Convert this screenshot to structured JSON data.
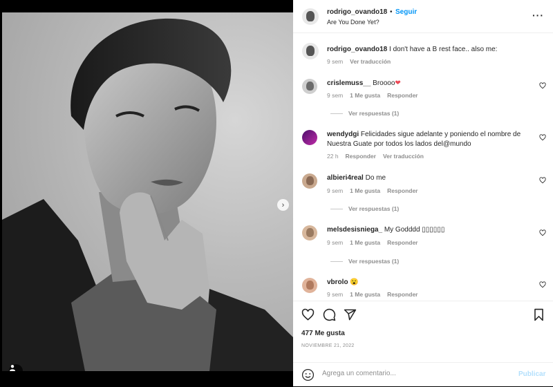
{
  "post": {
    "author": "rodrigo_ovando18",
    "separator": "•",
    "follow_label": "Seguir",
    "audio": "Are You Done Yet?",
    "more_icon": "more-horizontal-icon",
    "carousel": {
      "current": 1,
      "total": 4
    },
    "next_icon": "chevron-right-icon"
  },
  "caption": {
    "user": "rodrigo_ovando18",
    "text": " I don't have a B rest face.. also me:",
    "time": "9 sem",
    "translate": "Ver traducción"
  },
  "comments": [
    {
      "user": "crislemuss__",
      "text": " Broooo",
      "emoji": "❤",
      "time": "9 sem",
      "likes": "1 Me gusta",
      "reply": "Responder",
      "replies": "Ver respuestas (1)"
    },
    {
      "user": "wendydgi",
      "text": " Felicidades sigue adelante y poniendo el nombre de Nuestra Guate por todos los lados del@mundo",
      "time": "22 h",
      "reply": "Responder",
      "translate": "Ver traducción"
    },
    {
      "user": "albieri4real",
      "text": " Do me",
      "time": "9 sem",
      "likes": "1 Me gusta",
      "reply": "Responder",
      "replies": "Ver respuestas (1)"
    },
    {
      "user": "melsdesisniega_",
      "text": " My Godddd ▯▯▯▯▯▯",
      "time": "9 sem",
      "likes": "1 Me gusta",
      "reply": "Responder",
      "replies": "Ver respuestas (1)"
    },
    {
      "user": "vbrolo",
      "text": " ",
      "emoji": "😮",
      "time": "9 sem",
      "likes": "1 Me gusta",
      "reply": "Responder"
    }
  ],
  "actions": {
    "likes": "477 Me gusta",
    "date": "NOVIEMBRE 21, 2022",
    "icons": [
      "heart-icon",
      "comment-icon",
      "share-icon",
      "bookmark-icon"
    ]
  },
  "composer": {
    "placeholder": "Agrega un comentario...",
    "publish_label": "Publicar",
    "emoji_icon": "smiley-icon"
  },
  "colors": {
    "accent": "#0095f6",
    "publish_disabled": "#b2dffc",
    "like_red": "#ed4956"
  }
}
